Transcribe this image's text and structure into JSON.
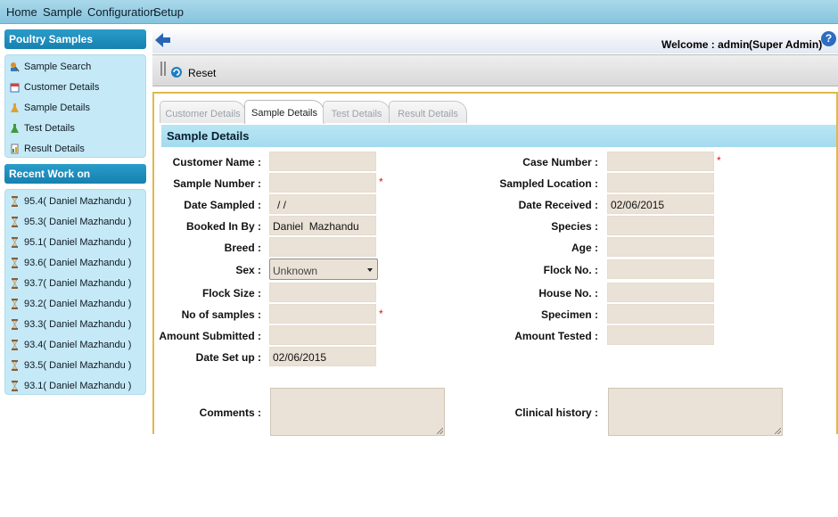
{
  "nav": {
    "items": [
      "Home",
      "Sample",
      "Configuration",
      "Setup"
    ]
  },
  "sidebar": {
    "poultry_header": "Poultry Samples",
    "poultry_items": [
      {
        "label": "Sample Search",
        "icon": "magnifier-person-icon"
      },
      {
        "label": "Customer Details",
        "icon": "calendar-icon"
      },
      {
        "label": "Sample Details",
        "icon": "flask-icon"
      },
      {
        "label": "Test Details",
        "icon": "green-flask-icon"
      },
      {
        "label": "Result Details",
        "icon": "report-icon"
      }
    ],
    "recent_header": "Recent Work on",
    "recent_items": [
      "95.4( Daniel Mazhandu )",
      "95.3( Daniel Mazhandu )",
      "95.1( Daniel Mazhandu )",
      "93.6( Daniel Mazhandu )",
      "93.7( Daniel Mazhandu )",
      "93.2( Daniel Mazhandu )",
      "93.3( Daniel Mazhandu )",
      "93.4( Daniel Mazhandu )",
      "93.5( Daniel Mazhandu )",
      "93.1( Daniel Mazhandu )"
    ]
  },
  "header": {
    "welcome": "Welcome : admin",
    "role": "(Super Admin)"
  },
  "toolbar": {
    "reset_label": "Reset"
  },
  "tabs": [
    "Customer Details",
    "Sample Details",
    "Test Details",
    "Result Details"
  ],
  "section_title": "Sample Details",
  "form_left": {
    "customer_name": {
      "label": "Customer Name :",
      "value": ""
    },
    "sample_number": {
      "label": "Sample Number :",
      "value": ""
    },
    "date_sampled": {
      "label": "Date Sampled :",
      "value": "/ /"
    },
    "booked_in_by": {
      "label": "Booked In By :",
      "value": "Daniel  Mazhandu"
    },
    "breed": {
      "label": "Breed :",
      "value": ""
    },
    "sex": {
      "label": "Sex :",
      "value": "Unknown"
    },
    "flock_size": {
      "label": "Flock Size :",
      "value": ""
    },
    "no_of_samples": {
      "label": "No of samples :",
      "value": ""
    },
    "amount_submitted": {
      "label": "Amount Submitted :",
      "value": ""
    },
    "date_set_up": {
      "label": "Date Set up :",
      "value": "02/06/2015"
    },
    "comments": {
      "label": "Comments :",
      "value": ""
    }
  },
  "form_right": {
    "case_number": {
      "label": "Case Number :",
      "value": ""
    },
    "sampled_location": {
      "label": "Sampled Location :",
      "value": ""
    },
    "date_received": {
      "label": "Date Received :",
      "value": "02/06/2015"
    },
    "species": {
      "label": "Species :",
      "value": ""
    },
    "age": {
      "label": "Age :",
      "value": ""
    },
    "flock_no": {
      "label": "Flock No. :",
      "value": ""
    },
    "house_no": {
      "label": "House No. :",
      "value": ""
    },
    "specimen": {
      "label": "Specimen :",
      "value": ""
    },
    "amount_tested": {
      "label": "Amount Tested :",
      "value": ""
    },
    "clinical_history": {
      "label": "Clinical history :",
      "value": ""
    }
  },
  "required_mark": "*",
  "colors": {
    "nav_bg": "#96cde2",
    "sidebar_header": "#1d8dbd",
    "sidebar_panel": "#c5e9f6",
    "field_bg": "#eae2d6",
    "section_bar": "#addff1",
    "required": "#d2181c",
    "frame": "#e1b84a"
  }
}
